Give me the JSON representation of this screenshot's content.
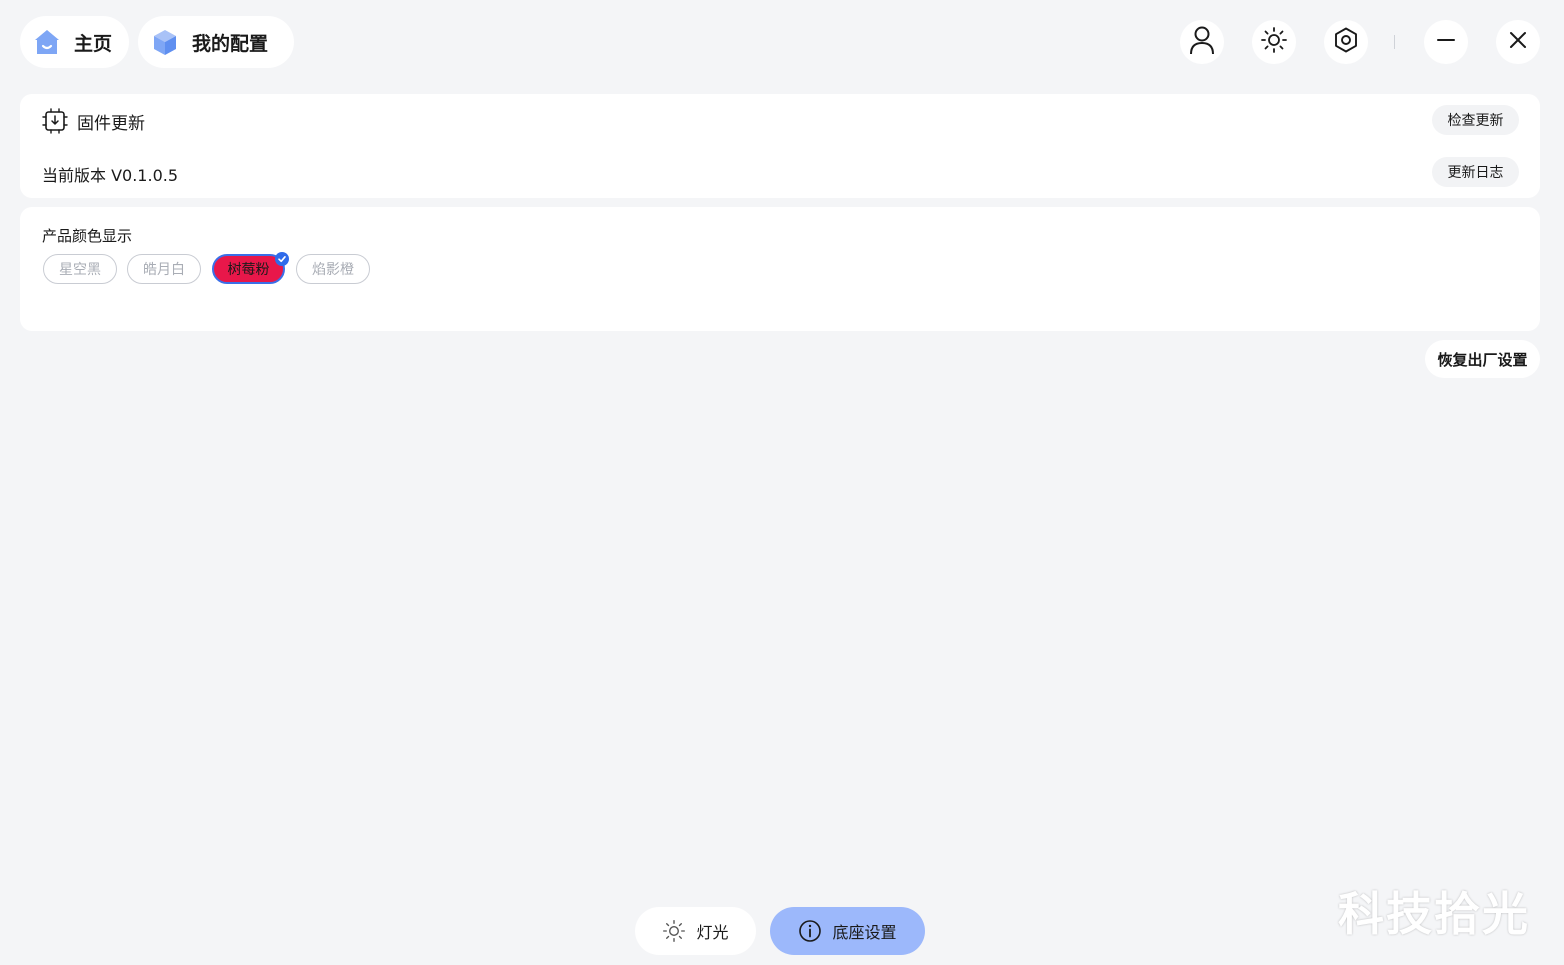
{
  "nav": {
    "home_label": "主页",
    "config_label": "我的配置"
  },
  "window_controls": {
    "icons": [
      "user-icon",
      "sun-icon",
      "settings-hex-icon",
      "minimize-icon",
      "close-icon"
    ]
  },
  "firmware": {
    "title": "固件更新",
    "check_update_label": "检查更新",
    "current_version_label": "当前版本 V0.1.0.5",
    "changelog_label": "更新日志"
  },
  "product_color": {
    "title": "产品颜色显示",
    "options": [
      "星空黑",
      "皓月白",
      "树莓粉",
      "焰影橙"
    ],
    "selected": "树莓粉",
    "selected_color": "#e8174a"
  },
  "reset_label": "恢复出厂设置",
  "bottom_tabs": {
    "light_label": "灯光",
    "base_settings_label": "底座设置",
    "active": "底座设置"
  },
  "watermark": "科技拾光",
  "colors": {
    "accent": "#2f6bea",
    "active_tab": "#9cb8fb",
    "background": "#f4f5f7"
  }
}
